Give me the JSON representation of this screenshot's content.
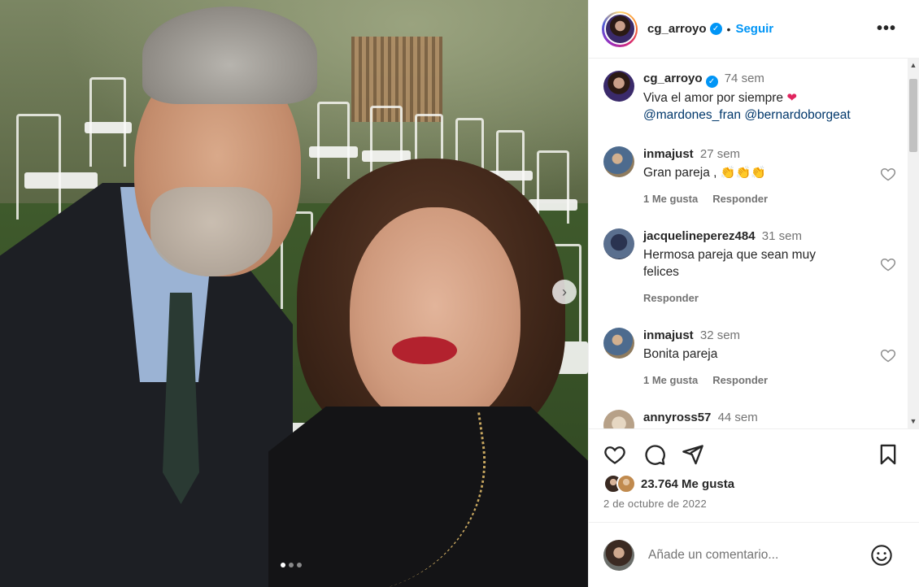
{
  "post": {
    "carousel": {
      "slides_total": 3,
      "active_index": 0
    },
    "next_icon": "chevron-right-icon"
  },
  "header": {
    "username": "cg_arroyo",
    "separator": "•",
    "follow_label": "Seguir",
    "more_label": "•••"
  },
  "caption": {
    "username": "cg_arroyo",
    "time": "74 sem",
    "text": "Viva el amor por siempre",
    "emoji": "❤",
    "mentions": [
      "@mardones_fran",
      "@bernardoborgeat"
    ]
  },
  "comments": [
    {
      "username": "inmajust",
      "time": "27 sem",
      "text": "Gran pareja ,",
      "emoji": "👏👏👏",
      "likes_label": "1 Me gusta",
      "reply_label": "Responder"
    },
    {
      "username": "jacquelineperez484",
      "time": "31 sem",
      "text": "Hermosa pareja que sean muy felices",
      "reply_label": "Responder"
    },
    {
      "username": "inmajust",
      "time": "32 sem",
      "text": "Bonita pareja",
      "likes_label": "1 Me gusta",
      "reply_label": "Responder"
    },
    {
      "username": "annyross57",
      "time": "44 sem"
    }
  ],
  "actions": {
    "like_icon": "heart-outline-icon",
    "comment_icon": "speech-bubble-icon",
    "share_icon": "paper-plane-icon",
    "save_icon": "bookmark-icon"
  },
  "likes": {
    "text": "23.764 Me gusta"
  },
  "date": "2 de octubre de 2022",
  "composer": {
    "placeholder": "Añade un comentario...",
    "emoji_icon": "smiley-icon"
  },
  "colors": {
    "link": "#0095f6",
    "mention": "#00376b",
    "muted": "#737373",
    "text": "#262626"
  }
}
